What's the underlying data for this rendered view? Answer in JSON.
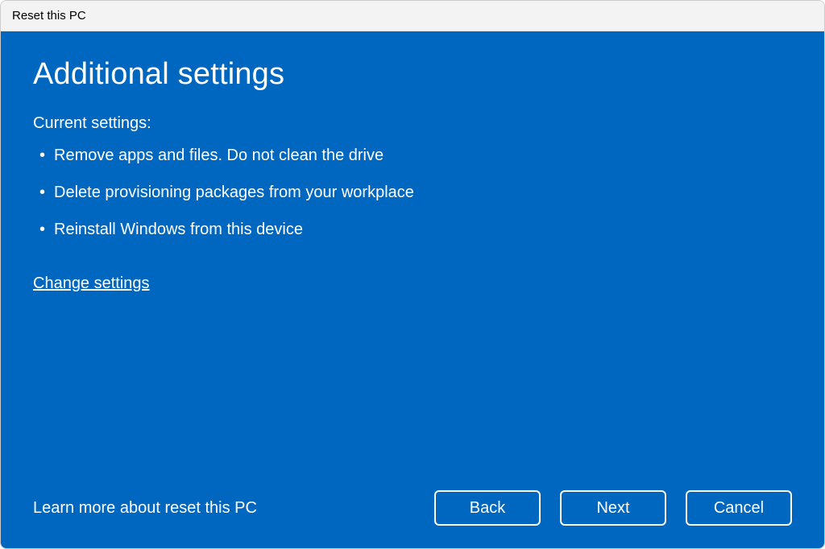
{
  "window": {
    "title": "Reset this PC"
  },
  "main": {
    "heading": "Additional settings",
    "subheading": "Current settings:",
    "settings": [
      "Remove apps and files. Do not clean the drive",
      "Delete provisioning packages from your workplace",
      "Reinstall Windows from this device"
    ],
    "change_link": "Change settings"
  },
  "footer": {
    "learn_more": "Learn more about reset this PC",
    "buttons": {
      "back": "Back",
      "next": "Next",
      "cancel": "Cancel"
    }
  }
}
